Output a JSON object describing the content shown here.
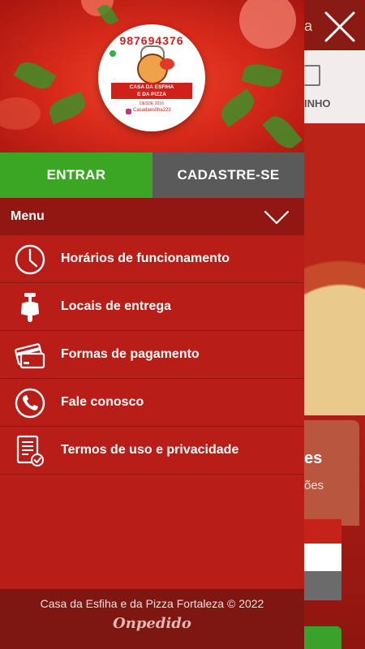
{
  "header": {
    "logo": {
      "phone": "987694376",
      "banner_line1": "CASA DA ESFIHA",
      "banner_line2": "E DA PIZZA",
      "since": "DESDE 2016",
      "instagram": "Casadaesfiha223"
    }
  },
  "auth": {
    "login_label": "ENTRAR",
    "signup_label": "CADASTRE-SE"
  },
  "menu": {
    "title": "Menu",
    "items": [
      {
        "label": "Horários de funcionamento",
        "icon": "clock-icon"
      },
      {
        "label": "Locais de entrega",
        "icon": "scooter-icon"
      },
      {
        "label": "Formas de pagamento",
        "icon": "credit-cards-icon"
      },
      {
        "label": "Fale conosco",
        "icon": "phone-icon"
      },
      {
        "label": "Termos de uso e privacidade",
        "icon": "document-check-icon"
      }
    ]
  },
  "footer": {
    "copyright": "Casa da Esfiha e da Pizza Fortaleza © 2022",
    "brand": "Onpedido"
  },
  "background": {
    "title_fragment": "a",
    "nav_fragment": "INHO",
    "card_title_fragment": "es",
    "card_subtitle_fragment": "ões"
  },
  "colors": {
    "primary_red": "#b91d17",
    "login_green": "#3ba524",
    "signup_gray": "#5a5a5a",
    "menu_header": "#921612",
    "footer": "#7e1611"
  }
}
